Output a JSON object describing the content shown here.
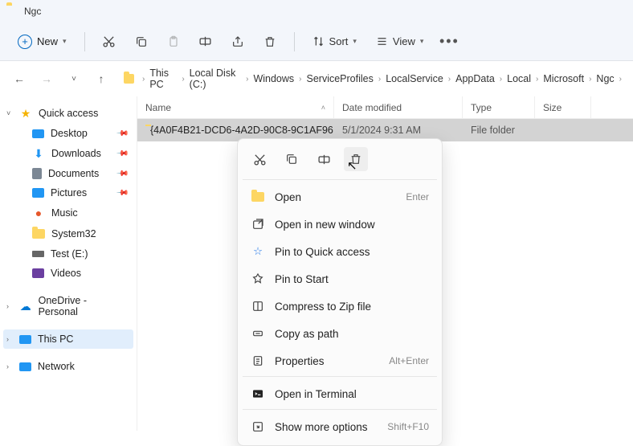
{
  "title": "Ngc",
  "toolbar": {
    "new_label": "New",
    "sort_label": "Sort",
    "view_label": "View"
  },
  "breadcrumbs": [
    "This PC",
    "Local Disk (C:)",
    "Windows",
    "ServiceProfiles",
    "LocalService",
    "AppData",
    "Local",
    "Microsoft",
    "Ngc"
  ],
  "sidebar": {
    "quick_access": {
      "label": "Quick access",
      "items": [
        {
          "label": "Desktop",
          "pinned": true
        },
        {
          "label": "Downloads",
          "pinned": true
        },
        {
          "label": "Documents",
          "pinned": true
        },
        {
          "label": "Pictures",
          "pinned": true
        },
        {
          "label": "Music",
          "pinned": false
        },
        {
          "label": "System32",
          "pinned": false
        },
        {
          "label": "Test (E:)",
          "pinned": false
        },
        {
          "label": "Videos",
          "pinned": false
        }
      ]
    },
    "onedrive": {
      "label": "OneDrive - Personal"
    },
    "thispc": {
      "label": "This PC"
    },
    "network": {
      "label": "Network"
    }
  },
  "columns": {
    "name": "Name",
    "date": "Date modified",
    "type": "Type",
    "size": "Size"
  },
  "rows": [
    {
      "name": "{4A0F4B21-DCD6-4A2D-90C8-9C1AF96...",
      "date": "5/1/2024 9:31 AM",
      "type": "File folder",
      "size": ""
    }
  ],
  "ctx": {
    "open": "Open",
    "open_accel": "Enter",
    "open_new_window": "Open in new window",
    "pin_quick": "Pin to Quick access",
    "pin_start": "Pin to Start",
    "compress": "Compress to Zip file",
    "copy_path": "Copy as path",
    "properties": "Properties",
    "properties_accel": "Alt+Enter",
    "open_terminal": "Open in Terminal",
    "show_more": "Show more options",
    "show_more_accel": "Shift+F10"
  }
}
